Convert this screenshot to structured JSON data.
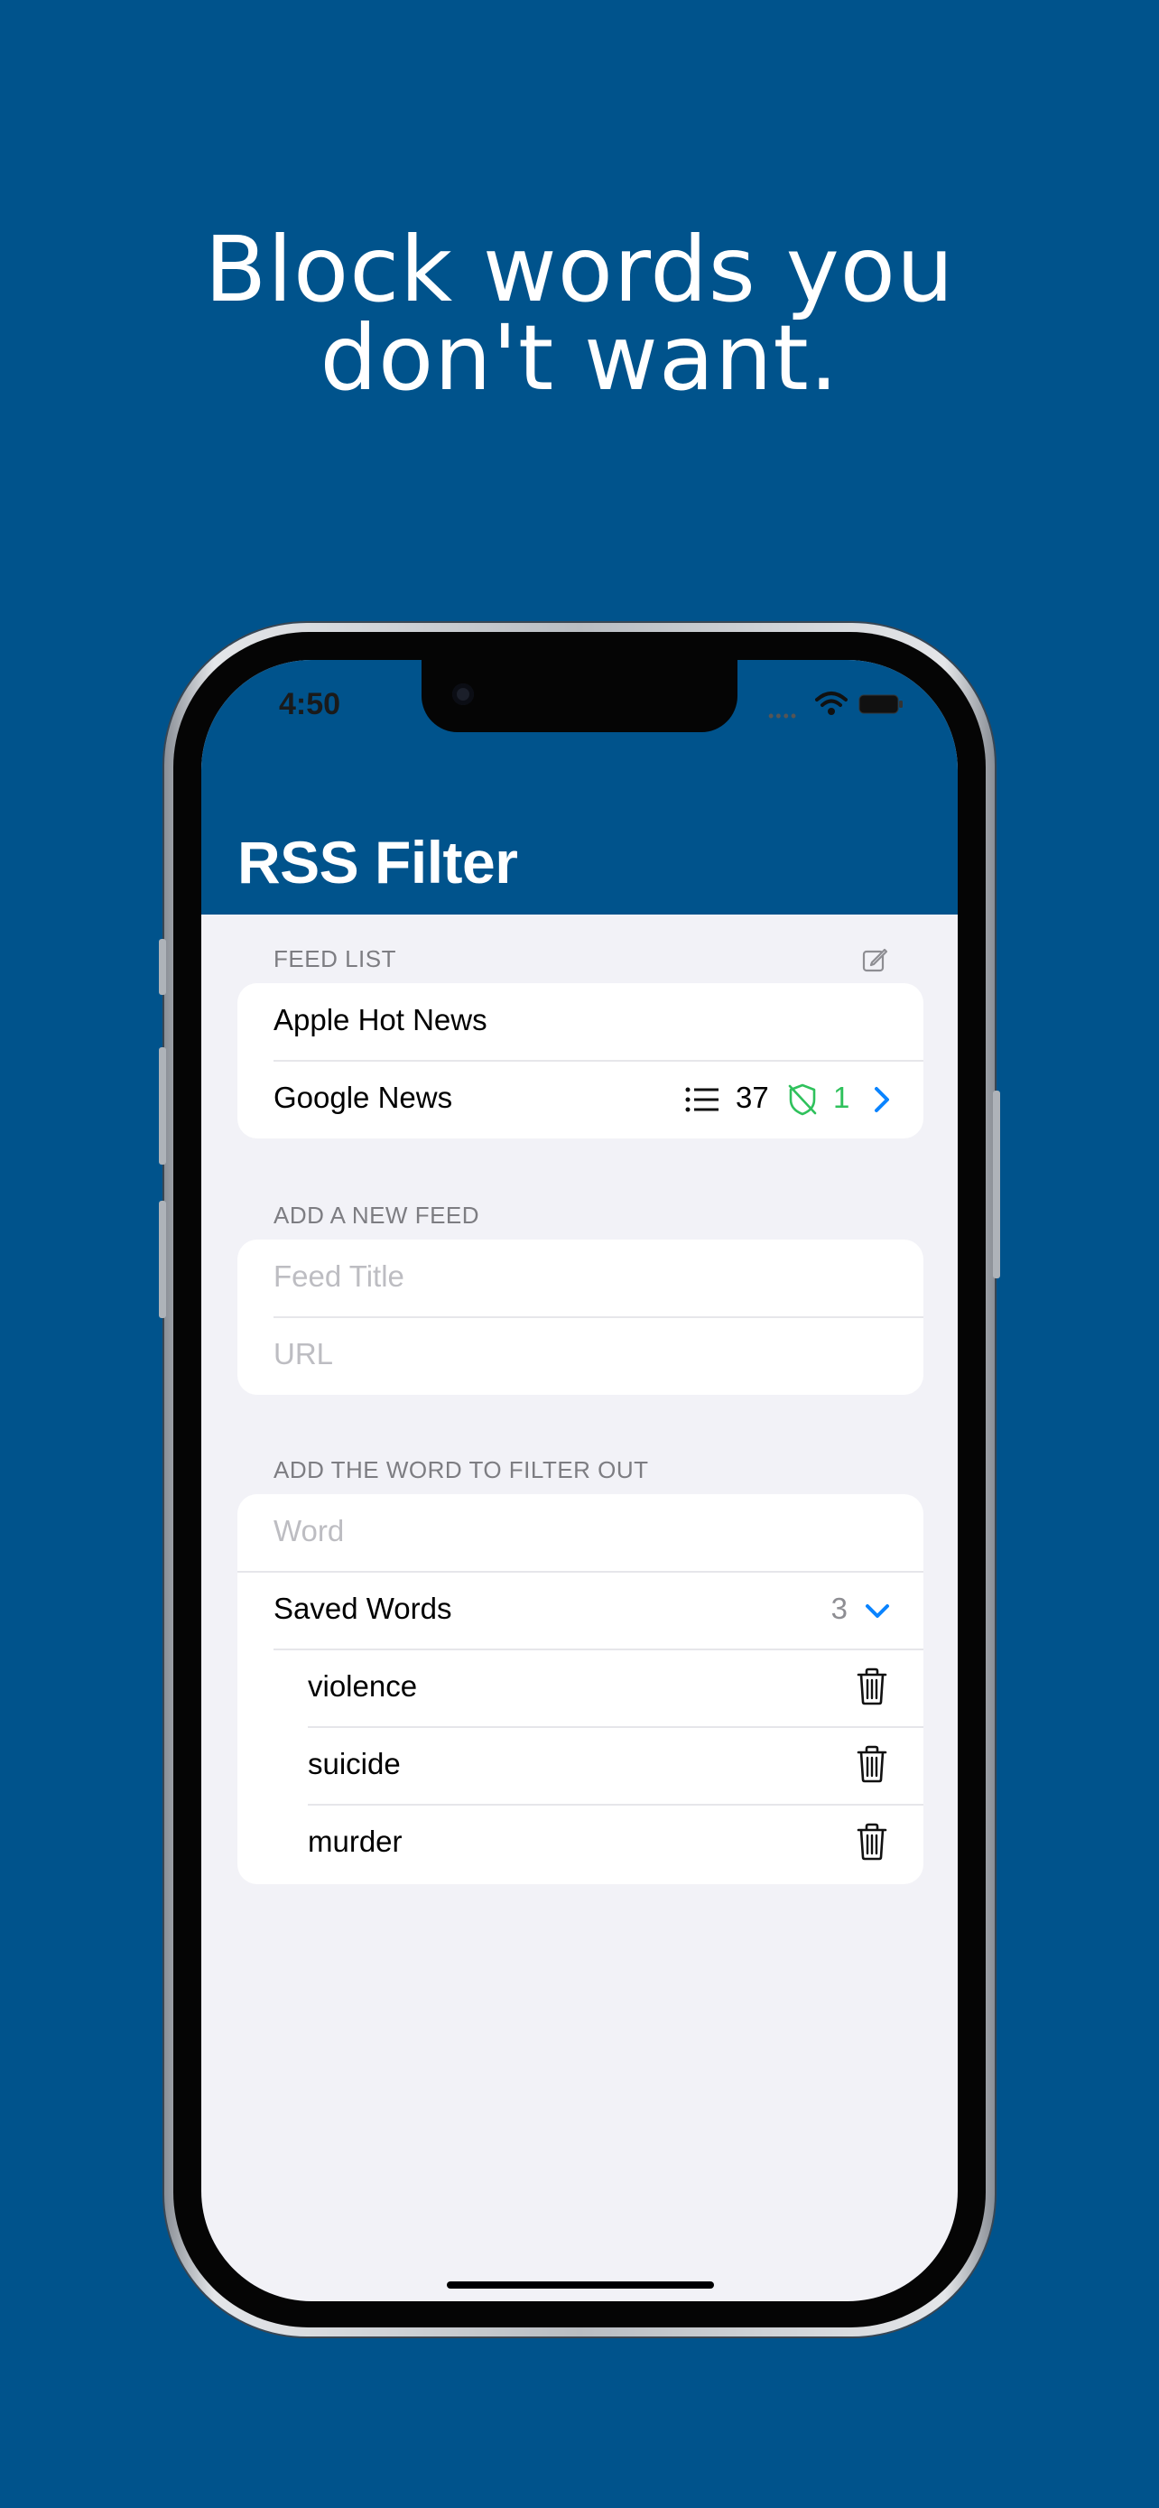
{
  "headline": {
    "line1": "Block words you",
    "line2": "don't want."
  },
  "status_bar": {
    "time": "4:50"
  },
  "nav": {
    "title": "RSS Filter"
  },
  "feed_list": {
    "header": "FEED LIST",
    "feeds": [
      {
        "title": "Apple Hot News"
      },
      {
        "title": "Google News",
        "item_count": "37",
        "blocked_count": "1"
      }
    ]
  },
  "add_feed": {
    "header": "ADD A NEW FEED",
    "title_placeholder": "Feed Title",
    "url_placeholder": "URL"
  },
  "filter": {
    "header": "ADD THE WORD TO FILTER OUT",
    "word_placeholder": "Word",
    "saved_label": "Saved Words",
    "saved_count": "3",
    "words": [
      "violence",
      "suicide",
      "murder"
    ]
  },
  "colors": {
    "brand": "#00538C",
    "background": "#F2F2F7",
    "accent_blue": "#0A84FF",
    "accent_green": "#2FC15C"
  }
}
